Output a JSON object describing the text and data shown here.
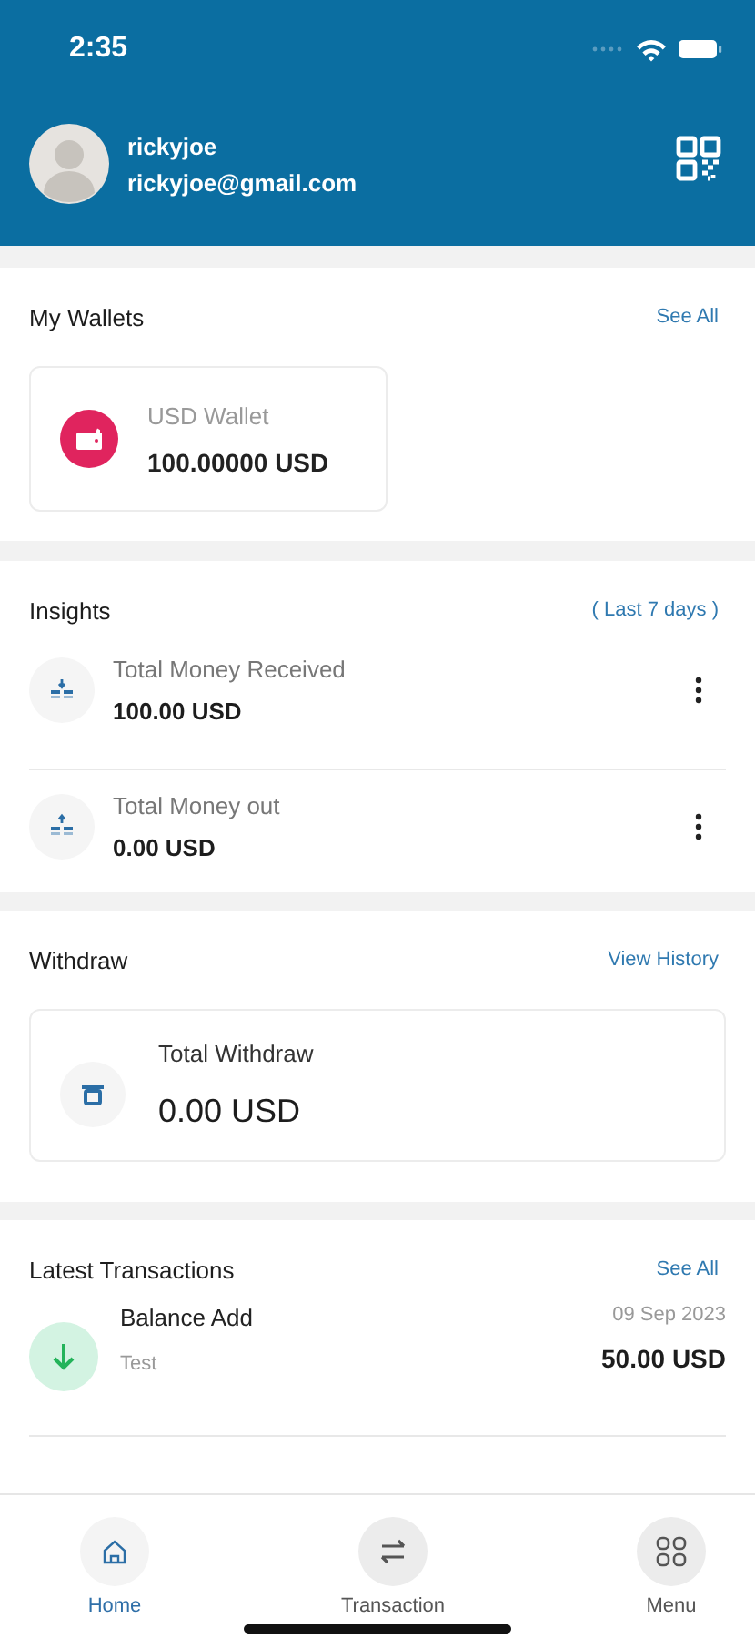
{
  "status_bar": {
    "time": "2:35"
  },
  "profile": {
    "name": "rickyjoe",
    "email": "rickyjoe@gmail.com"
  },
  "wallets": {
    "title": "My Wallets",
    "link": "See All",
    "items": [
      {
        "name": "USD Wallet",
        "amount": "100.00000 USD",
        "color": "#e0245e"
      }
    ]
  },
  "insights": {
    "title": "Insights",
    "period": "( Last 7 days )",
    "items": [
      {
        "kind": "in",
        "label": "Total Money Received",
        "amount": "100.00 USD"
      },
      {
        "kind": "out",
        "label": "Total Money out",
        "amount": "0.00 USD"
      }
    ]
  },
  "withdraw": {
    "title": "Withdraw",
    "link": "View History",
    "label": "Total Withdraw",
    "amount": "0.00 USD"
  },
  "transactions": {
    "title": "Latest Transactions",
    "link": "See All",
    "items": [
      {
        "title": "Balance Add",
        "note": "Test",
        "date": "09 Sep 2023",
        "amount": "50.00 USD"
      }
    ]
  },
  "nav": [
    {
      "kind": "home",
      "label": "Home",
      "selected": true
    },
    {
      "kind": "swap",
      "label": "Transaction",
      "selected": false
    },
    {
      "kind": "grid",
      "label": "Menu",
      "selected": false
    }
  ]
}
